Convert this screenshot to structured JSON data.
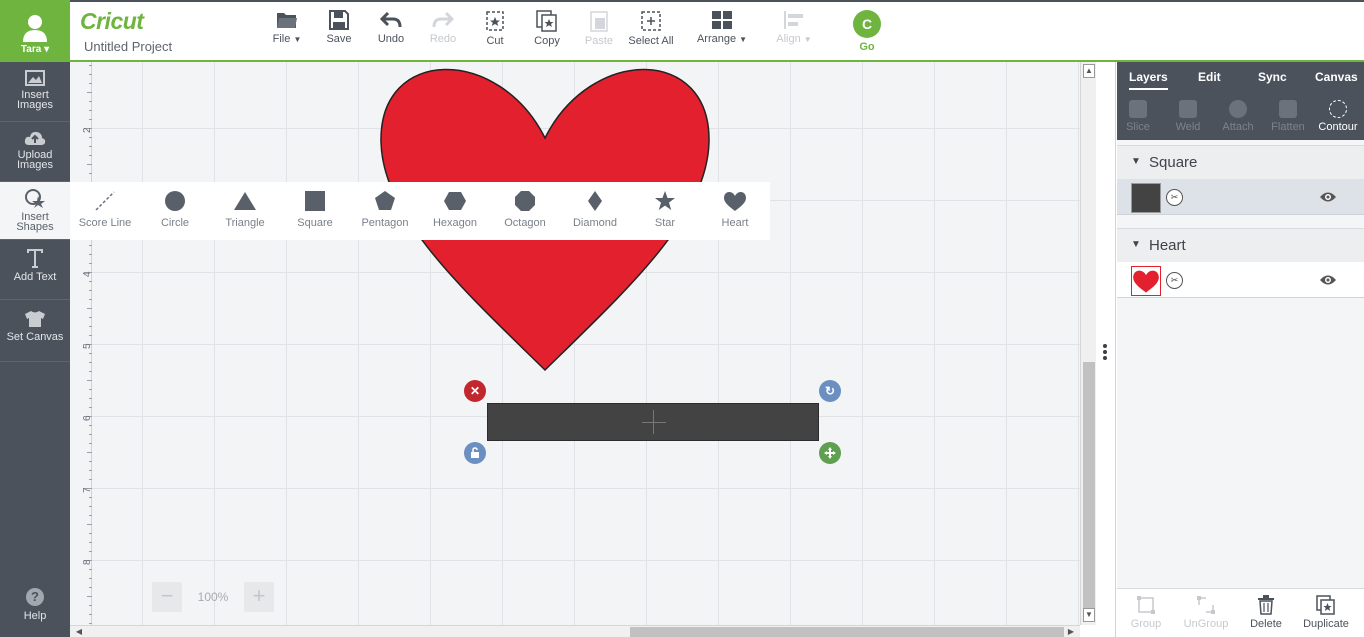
{
  "app": {
    "logo": "Cricut",
    "project_name": "Untitled Project",
    "brand_color": "#6eb43f"
  },
  "user": {
    "name": "Tara"
  },
  "sidebar": {
    "items": [
      {
        "label": "Insert\nImages",
        "icon": "image-icon"
      },
      {
        "label": "Upload\nImages",
        "icon": "upload-cloud-icon"
      },
      {
        "label": "Insert\nShapes",
        "icon": "shapes-icon"
      },
      {
        "label": "Add Text",
        "icon": "text-icon"
      },
      {
        "label": "Set Canvas",
        "icon": "tshirt-icon"
      }
    ],
    "help_label": "Help"
  },
  "toolbar": {
    "file": "File",
    "save": "Save",
    "undo": "Undo",
    "redo": "Redo",
    "cut": "Cut",
    "copy": "Copy",
    "paste": "Paste",
    "select_all": "Select All",
    "arrange": "Arrange",
    "align": "Align",
    "go": "Go"
  },
  "shapes": [
    "Score Line",
    "Circle",
    "Triangle",
    "Square",
    "Pentagon",
    "Hexagon",
    "Octagon",
    "Diamond",
    "Star",
    "Heart"
  ],
  "ruler": {
    "labels": [
      "2",
      "3",
      "4",
      "5",
      "6",
      "7",
      "8"
    ]
  },
  "zoom": {
    "value": "100%",
    "minus": "−",
    "plus": "+"
  },
  "right_panel": {
    "tabs": [
      "Layers",
      "Edit",
      "Sync",
      "Canvas"
    ],
    "active_tab": "Layers",
    "tools": [
      "Slice",
      "Weld",
      "Attach",
      "Flatten",
      "Contour"
    ],
    "groups": [
      {
        "name": "Square",
        "color": "#434343"
      },
      {
        "name": "Heart",
        "color": "#e0222d"
      }
    ],
    "bottom": [
      "Group",
      "UnGroup",
      "Delete",
      "Duplicate"
    ]
  },
  "colors": {
    "heart": "#e3202e",
    "delete_handle": "#c1272d",
    "rotate_handle": "#6b8fc0",
    "lock_handle": "#6b8fc0",
    "resize_handle": "#5ea050"
  }
}
